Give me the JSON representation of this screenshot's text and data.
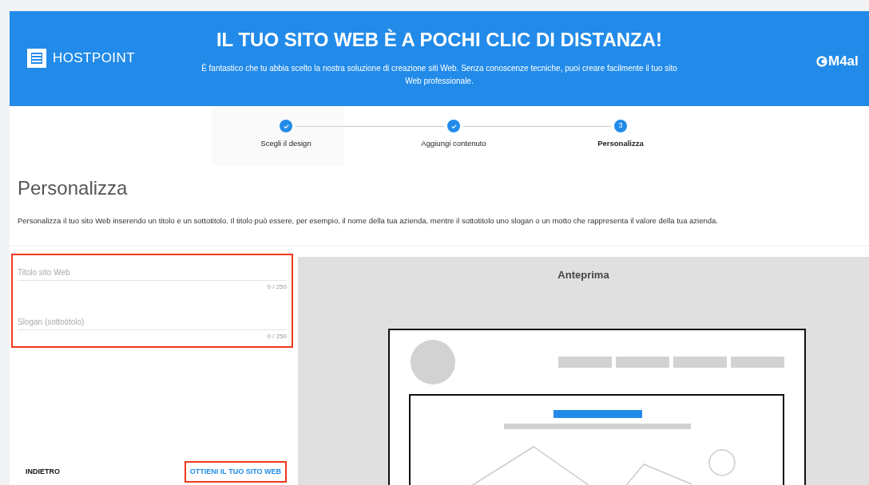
{
  "header": {
    "logo": "HOSTPOINT",
    "title": "IL TUO SITO WEB È A POCHI CLIC DI DISTANZA!",
    "subtitle": "È fantastico che tu abbia scelto la nostra soluzione di creazione siti Web. Senza conoscenze tecniche, puoi creare facilmente il tuo sito Web professionale.",
    "partner_logo": "M4al"
  },
  "steps": [
    {
      "label": "Scegli il design",
      "done": true,
      "selected": false
    },
    {
      "label": "Aggiungi contenuto",
      "done": true,
      "selected": false
    },
    {
      "label": "Personalizza",
      "done": false,
      "selected": true,
      "marker": "3"
    }
  ],
  "page": {
    "heading": "Personalizza",
    "description": "Personalizza il tuo sito Web inserendo un titolo e un sottotitolo. Il titolo può essere, per esempio, il nome della tua azienda, mentre il sottotitolo uno slogan o un motto che rappresenta il valore della tua azienda."
  },
  "fields": [
    {
      "placeholder": "Titolo sito Web",
      "counter": "0 / 250"
    },
    {
      "placeholder": "Slogan (sottotitolo)",
      "counter": "0 / 250"
    }
  ],
  "buttons": {
    "back": "INDIETRO",
    "primary": "OTTIENI IL TUO SITO WEB"
  },
  "preview": {
    "title": "Anteprima"
  }
}
